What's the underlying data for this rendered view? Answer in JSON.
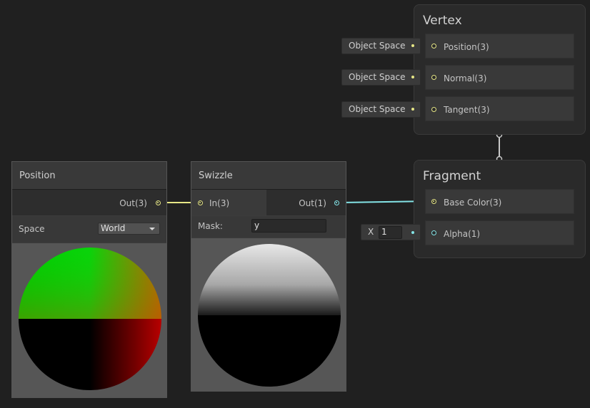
{
  "vertex": {
    "title": "Vertex",
    "ports": [
      {
        "label": "Position(3)",
        "control": "Object Space"
      },
      {
        "label": "Normal(3)",
        "control": "Object Space"
      },
      {
        "label": "Tangent(3)",
        "control": "Object Space"
      }
    ]
  },
  "fragment": {
    "title": "Fragment",
    "base_color": {
      "label": "Base Color(3)"
    },
    "alpha": {
      "label": "Alpha(1)",
      "control_axis": "X",
      "control_value": "1"
    }
  },
  "position_node": {
    "title": "Position",
    "output_label": "Out(3)",
    "space_label": "Space",
    "space_value": "World"
  },
  "swizzle_node": {
    "title": "Swizzle",
    "input_label": "In(3)",
    "output_label": "Out(1)",
    "mask_label": "Mask:",
    "mask_value": "y"
  },
  "colors": {
    "vector3_port": "#e6e686",
    "vector1_port": "#84e4e7",
    "background": "#202020",
    "node_header": "#393939"
  }
}
